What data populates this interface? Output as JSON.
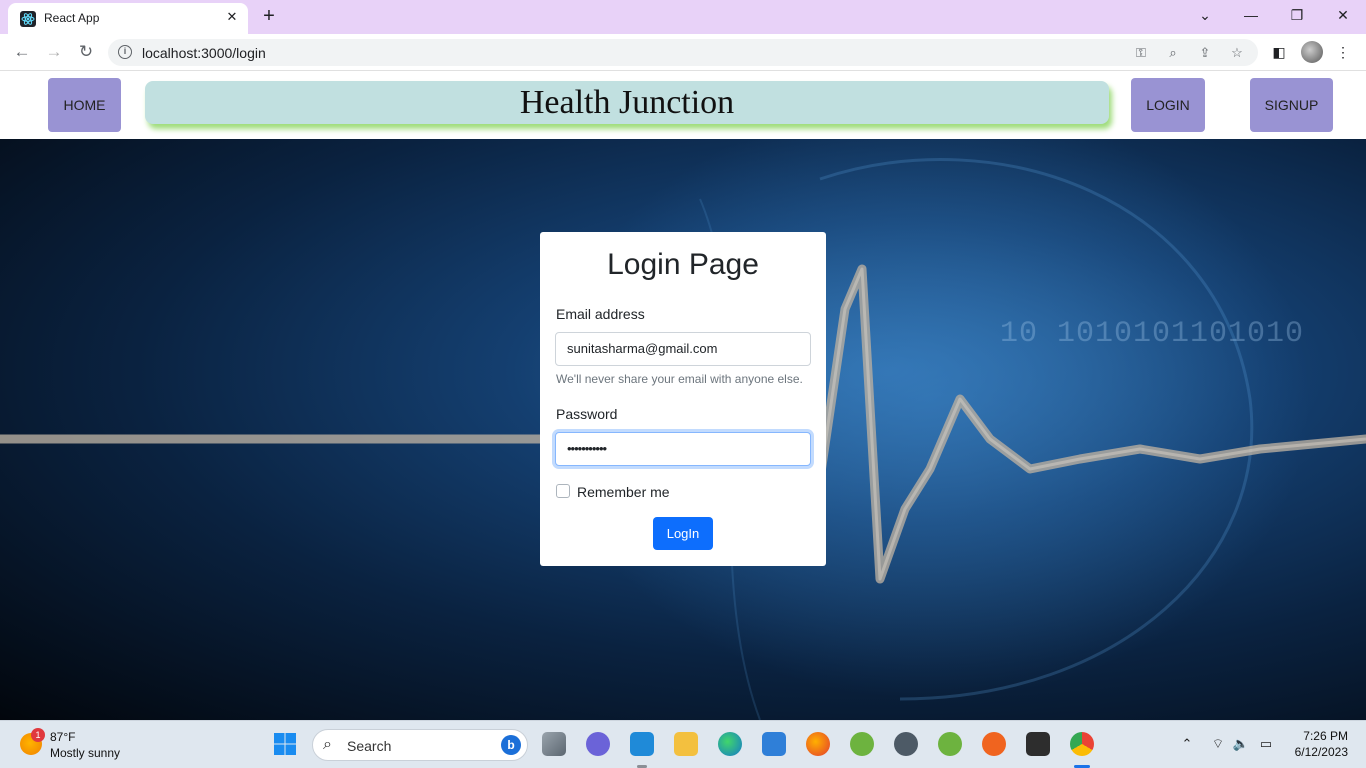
{
  "browser": {
    "tab_title": "React App",
    "url": "localhost:3000/login"
  },
  "header": {
    "home": "HOME",
    "brand": "Health Junction",
    "login": "LOGIN",
    "signup": "SIGNUP"
  },
  "form": {
    "title": "Login Page",
    "email_label": "Email address",
    "email_value": "sunitasharma@gmail.com",
    "email_help": "We'll never share your email with anyone else.",
    "password_label": "Password",
    "password_value": "•••••••••••",
    "remember_label": "Remember me",
    "submit_label": "LogIn"
  },
  "taskbar": {
    "weather_temp": "87°F",
    "weather_desc": "Mostly sunny",
    "weather_badge": "1",
    "search_placeholder": "Search",
    "time": "7:26 PM",
    "date": "6/12/2023"
  },
  "colors": {
    "nav_button": "#9993d3",
    "brand_bg": "#c1e0e0",
    "primary_button": "#0d6efd",
    "tabstrip": "#e8d2f8"
  }
}
